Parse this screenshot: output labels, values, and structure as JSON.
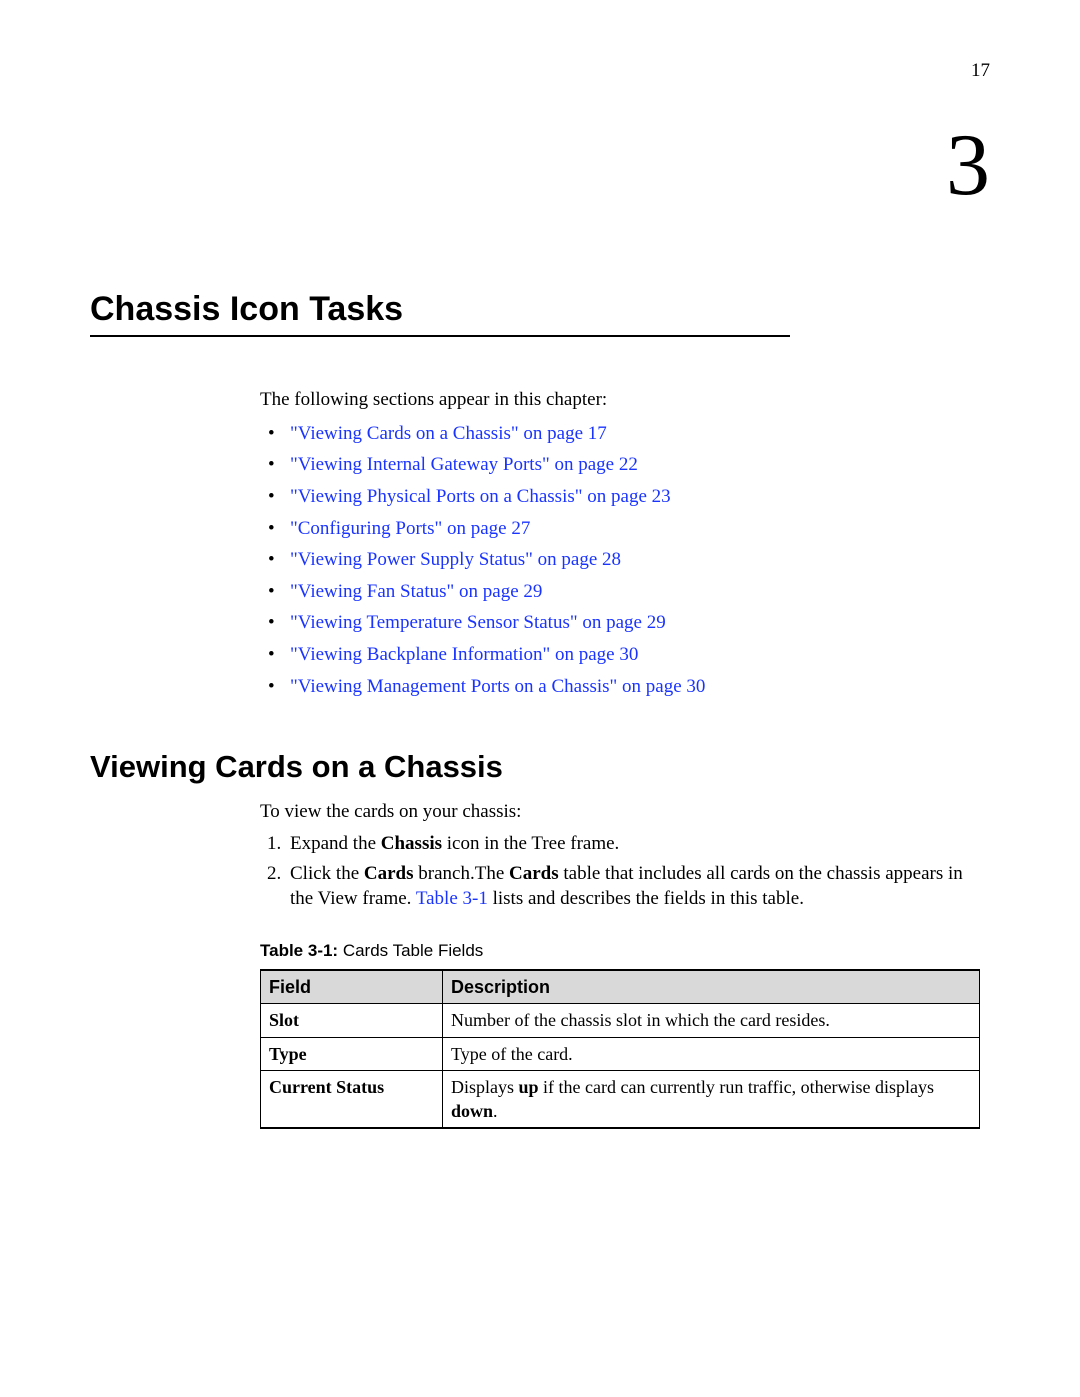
{
  "page_number": "17",
  "chapter_number": "3",
  "chapter_title": "Chassis Icon Tasks",
  "intro_sentence": "The following sections appear in this chapter:",
  "toc": [
    "\"Viewing Cards on a Chassis\" on page 17",
    "\"Viewing Internal Gateway Ports\" on page 22",
    "\"Viewing Physical Ports on a Chassis\" on page 23",
    "\"Configuring Ports\" on page 27",
    "\"Viewing Power Supply Status\" on page 28",
    "\"Viewing Fan Status\" on page 29",
    "\"Viewing Temperature Sensor Status\" on page 29",
    "\"Viewing Backplane Information\" on page 30",
    "\"Viewing Management Ports on a Chassis\" on page 30"
  ],
  "section_title": "Viewing Cards on a Chassis",
  "section_intro": "To view the cards on your chassis:",
  "steps": {
    "s1_a": "Expand the ",
    "s1_b": "Chassis",
    "s1_c": " icon in the Tree frame.",
    "s2_a": "Click the ",
    "s2_b": "Cards",
    "s2_c": " branch.The ",
    "s2_d": "Cards",
    "s2_e": " table that includes all cards on the chassis appears in the View frame. ",
    "s2_link": "Table 3-1",
    "s2_f": " lists and describes the fields in this table."
  },
  "table_caption_label": "Table 3-1:",
  "table_caption_text": " Cards Table Fields",
  "table": {
    "head_field": "Field",
    "head_desc": "Description",
    "rows": [
      {
        "field": "Slot",
        "desc": "Number of the chassis slot in which the card resides."
      },
      {
        "field": "Type",
        "desc": "Type of the card."
      }
    ],
    "row3_field": "Current Status",
    "row3_a": "Displays ",
    "row3_b": "up",
    "row3_c": " if the card can currently run traffic, otherwise displays ",
    "row3_d": "down",
    "row3_e": "."
  }
}
